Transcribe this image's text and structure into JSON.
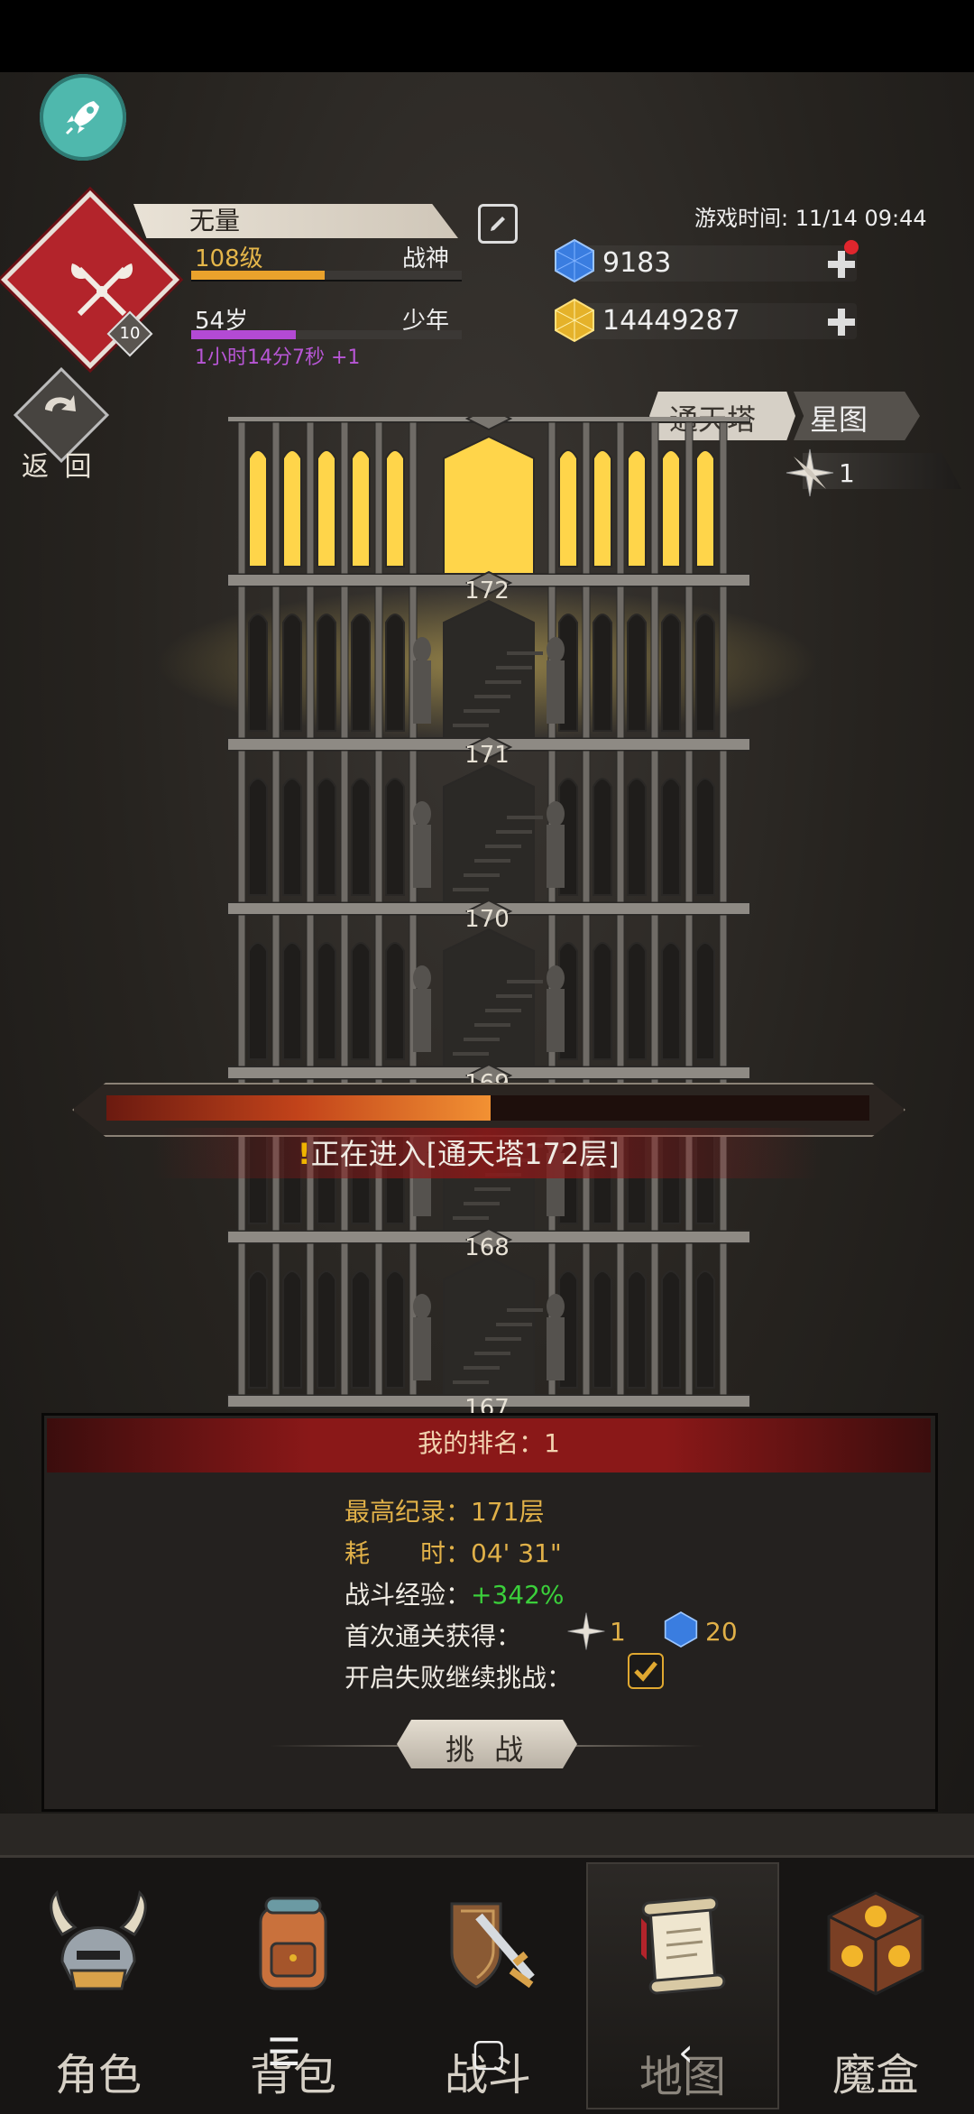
{
  "player": {
    "name": "无量",
    "level": "108级",
    "rank_title": "战神",
    "level_progress": 0.49,
    "age": "54岁",
    "age_stage": "少年",
    "age_progress": 0.39,
    "age_timer": "1小时14分7秒 +1",
    "emblem_level": "10"
  },
  "game_time": "游戏时间: 11/14 09:44",
  "currency": {
    "gems": "9183",
    "gold": "14449287"
  },
  "nav_back_label": "返 回",
  "tabs": {
    "tower": "通天塔",
    "star_map": "星图",
    "star_count": "1"
  },
  "tower": {
    "floors": [
      "172",
      "171",
      "170",
      "169",
      "168",
      "167"
    ],
    "active_floor": "172",
    "entering_text": "正在进入[通天塔172层]",
    "entering_progress": 0.47
  },
  "rank_panel": {
    "title": "我的排名：1",
    "best_record_label": "最高纪录：",
    "best_record_value": "171层",
    "time_label": "耗　　时：",
    "time_value": "04' 31\"",
    "exp_label": "战斗经验：",
    "exp_value": "+342%",
    "first_clear_label": "首次通关获得：",
    "first_clear_star": "1",
    "first_clear_gems": "20",
    "continue_label": "开启失败继续挑战：",
    "continue_checked": true,
    "challenge_button": "挑 战"
  },
  "bottom_nav": [
    {
      "label": "角色",
      "icon": "helmet-icon"
    },
    {
      "label": "背包",
      "icon": "backpack-icon"
    },
    {
      "label": "战斗",
      "icon": "sword-shield-icon"
    },
    {
      "label": "地图",
      "icon": "scroll-map-icon",
      "active": true
    },
    {
      "label": "魔盒",
      "icon": "magic-box-icon"
    }
  ],
  "colors": {
    "accent_gold": "#e0b048",
    "level_bar": "#eaa22c",
    "age_bar": "#b34ad4",
    "exp_green": "#3bd03b",
    "panel_header_red": "#8a1818"
  }
}
